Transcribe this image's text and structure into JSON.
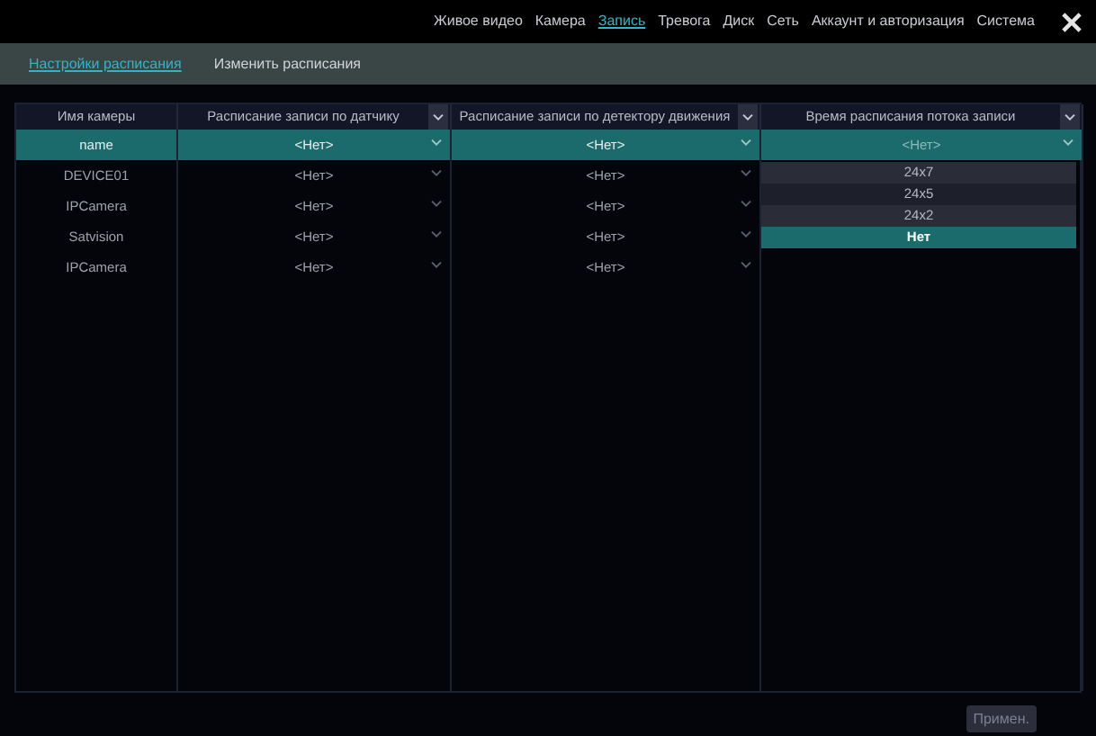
{
  "nav": [
    {
      "label": "Живое видео",
      "selected": false
    },
    {
      "label": "Камера",
      "selected": false
    },
    {
      "label": "Запись",
      "selected": true
    },
    {
      "label": "Тревога",
      "selected": false
    },
    {
      "label": "Диск",
      "selected": false
    },
    {
      "label": "Сеть",
      "selected": false
    },
    {
      "label": "Аккаунт и авторизация",
      "selected": false
    },
    {
      "label": "Система",
      "selected": false
    }
  ],
  "tabs": [
    {
      "label": "Настройки расписания",
      "selected": true
    },
    {
      "label": "Изменить расписания",
      "selected": false
    }
  ],
  "table": {
    "columns": [
      {
        "label": "Имя камеры",
        "dropdown": false
      },
      {
        "label": "Расписание записи по датчику",
        "dropdown": true
      },
      {
        "label": "Расписание записи по детектору движения",
        "dropdown": true
      },
      {
        "label": "Время расписания потока записи",
        "dropdown": true
      }
    ],
    "rows": [
      {
        "selected": true,
        "cells": [
          "name",
          "<Нет>",
          "<Нет>",
          "<Нет>"
        ]
      },
      {
        "selected": false,
        "cells": [
          "DEVICE01",
          "<Нет>",
          "<Нет>"
        ]
      },
      {
        "selected": false,
        "cells": [
          "IPCamera",
          "<Нет>",
          "<Нет>"
        ]
      },
      {
        "selected": false,
        "cells": [
          "Satvision",
          "<Нет>",
          "<Нет>"
        ]
      },
      {
        "selected": false,
        "cells": [
          "IPCamera",
          "<Нет>",
          "<Нет>"
        ]
      }
    ]
  },
  "dropdown": {
    "options": [
      {
        "label": "24x7",
        "selected": false
      },
      {
        "label": "24x5",
        "selected": false
      },
      {
        "label": "24x2",
        "selected": false
      },
      {
        "label": "Нет",
        "selected": true
      }
    ]
  },
  "apply_button": "Примен."
}
